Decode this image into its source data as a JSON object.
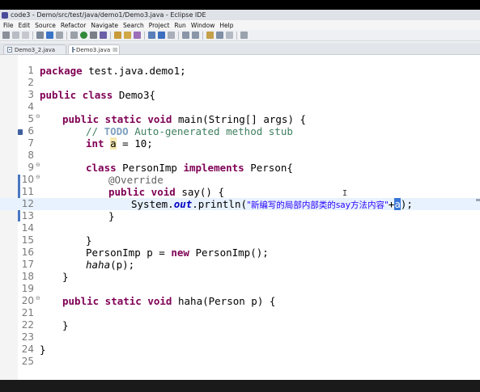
{
  "window": {
    "title": "code3 - Demo/src/test/java/demo1/Demo3.java - Eclipse IDE"
  },
  "menu": [
    "File",
    "Edit",
    "Source",
    "Refactor",
    "Navigate",
    "Search",
    "Project",
    "Run",
    "Window",
    "Help"
  ],
  "tabs": [
    {
      "label": "Demo3_2.java",
      "active": false
    },
    {
      "label": "Demo3.java",
      "active": true,
      "close": "☒"
    }
  ],
  "editor": {
    "lines": [
      {
        "num": "1"
      },
      {
        "num": "2"
      },
      {
        "num": "3"
      },
      {
        "num": "4"
      },
      {
        "num": "5",
        "fold": "⊖"
      },
      {
        "num": "6"
      },
      {
        "num": "7"
      },
      {
        "num": "8"
      },
      {
        "num": "9",
        "fold": "⊖"
      },
      {
        "num": "10",
        "fold": "⊖"
      },
      {
        "num": "11"
      },
      {
        "num": "12"
      },
      {
        "num": "13"
      },
      {
        "num": "14"
      },
      {
        "num": "15"
      },
      {
        "num": "16"
      },
      {
        "num": "17"
      },
      {
        "num": "18"
      },
      {
        "num": "19"
      },
      {
        "num": "20",
        "fold": "⊖"
      },
      {
        "num": "21"
      },
      {
        "num": "22"
      },
      {
        "num": "23"
      },
      {
        "num": "24"
      },
      {
        "num": "25"
      }
    ],
    "code": {
      "l1_kw": "package",
      "l1_rest": " test.java.demo1;",
      "l3_kw": "public class",
      "l3_rest": " Demo3{",
      "l5_kw": "public static void",
      "l5_rest": " main(String[] args) {",
      "l6_pre": "// ",
      "l6_todo": "TODO",
      "l6_rest": " Auto-generated method stub",
      "l7_kw": "int",
      "l7_sp": " ",
      "l7_var": "a",
      "l7_rest": " = 10;",
      "l9_kw1": "class",
      "l9_mid": " PersonImp ",
      "l9_kw2": "implements",
      "l9_rest": " Person{",
      "l10_ann": "@Override",
      "l11_kw": "public void",
      "l11_rest": " say() {",
      "l12_pre": "System.",
      "l12_out": "out",
      "l12_mid": ".println(",
      "l12_str": "\"新编写的局部内部类的say方法内容\"",
      "l12_plus": "+",
      "l12_caret": "a",
      "l12_end": ");",
      "l13": "}",
      "l15": "}",
      "l16_pre": "PersonImp p = ",
      "l16_kw": "new",
      "l16_rest": " PersonImp();",
      "l17_st": "haha",
      "l17_rest": "(p);",
      "l18": "}",
      "l20_kw": "public static void",
      "l20_rest": " haha(Person p) {",
      "l22": "}",
      "l24": "}"
    }
  },
  "colors": {
    "keyword": "#7f0055",
    "comment": "#3f7f5f",
    "string": "#2a00ff",
    "field": "#0000c0",
    "current_line": "#e8f2fe"
  }
}
